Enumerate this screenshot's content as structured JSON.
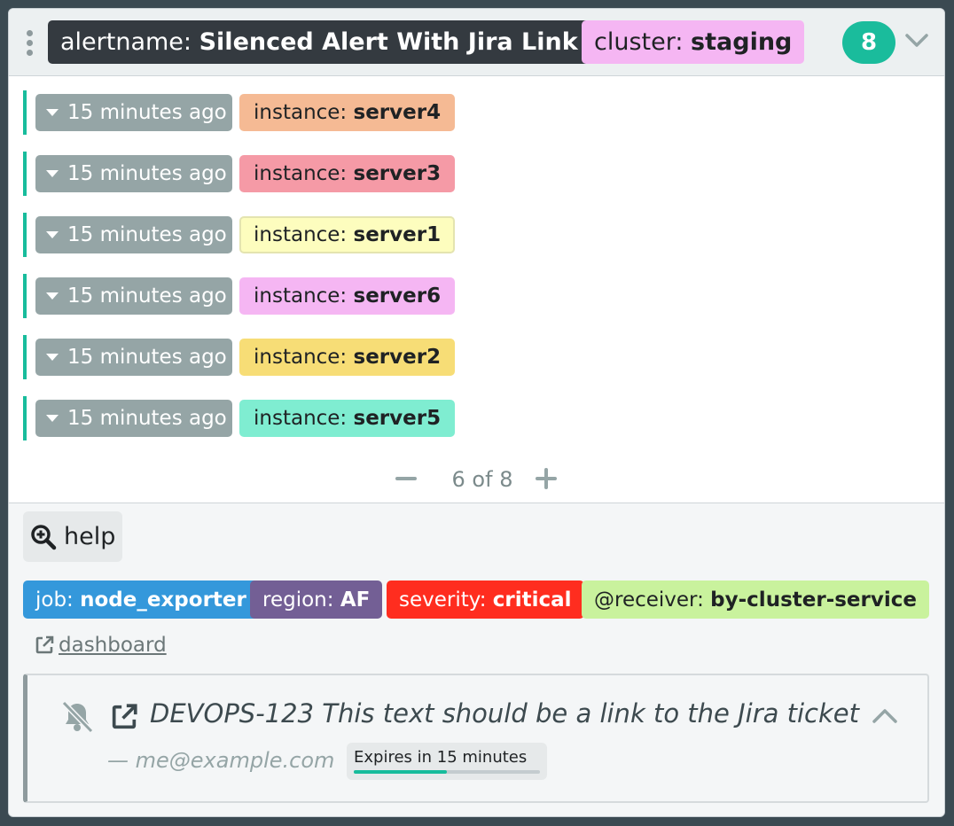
{
  "group": {
    "alertname_key": "alertname:",
    "alertname_value": "Silenced Alert With Jira Link",
    "cluster_key": "cluster:",
    "cluster_value": "staging",
    "count": "8",
    "collapse_icon": "chevron-down-icon",
    "colors": {
      "header_bg": "#ecf0f1",
      "alertname_bg": "#343a40",
      "cluster_bg": "#f5b6f3",
      "count_bg": "#1abc9c"
    }
  },
  "alerts": [
    {
      "time": "15 minutes ago",
      "label_key": "instance:",
      "label_value": "server4",
      "color": "#f5ba94",
      "border": "#f5ba94"
    },
    {
      "time": "15 minutes ago",
      "label_key": "instance:",
      "label_value": "server3",
      "color": "#f59aa6",
      "border": "#f59aa6"
    },
    {
      "time": "15 minutes ago",
      "label_key": "instance:",
      "label_value": "server1",
      "color": "#fdfdbe",
      "border": "#e4e4b0"
    },
    {
      "time": "15 minutes ago",
      "label_key": "instance:",
      "label_value": "server6",
      "color": "#f5b6f3",
      "border": "#f5b6f3"
    },
    {
      "time": "15 minutes ago",
      "label_key": "instance:",
      "label_value": "server2",
      "color": "#f7dd76",
      "border": "#f7dd76"
    },
    {
      "time": "15 minutes ago",
      "label_key": "instance:",
      "label_value": "server5",
      "color": "#7fedd1",
      "border": "#7fedd1"
    }
  ],
  "pager": {
    "text": "6 of 8"
  },
  "footer": {
    "help_label": "help",
    "shared_labels": [
      {
        "key": "job:",
        "value": "node_exporter",
        "color": "#3498db"
      },
      {
        "key": "region:",
        "value": "AF",
        "color": "#735f95"
      },
      {
        "key": "severity:",
        "value": "critical",
        "color": "#ff2d1f"
      },
      {
        "key": "@receiver:",
        "value": "by-cluster-service",
        "color": "#c9f29d"
      }
    ],
    "dashboard_link": "dashboard"
  },
  "silence": {
    "comment": "DEVOPS-123 This text should be a link to the Jira ticket",
    "author": "— me@example.com",
    "expires": "Expires in 15 minutes",
    "expires_progress": 0.5
  }
}
